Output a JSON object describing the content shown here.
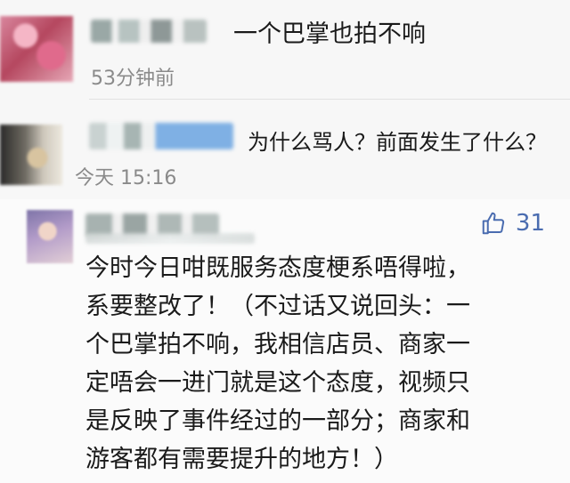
{
  "comments": [
    {
      "text": "一个巴掌也拍不响",
      "time": "53分钟前"
    },
    {
      "text": "为什么骂人？前面发生了什么？",
      "time": "今天 15:16"
    },
    {
      "likes": "31",
      "text_lines": [
        "今时今日咁既服务态度梗系唔得啦，",
        "系要整改了！（不过话又说回头：一",
        "个巴掌拍不响，我相信店员、商家一",
        "定唔会一进门就是这个态度，视频只",
        "是反映了事件经过的一部分；商家和",
        "游客都有需要提升的地方！）"
      ]
    }
  ],
  "icons": {
    "like": "thumbs-up-icon"
  },
  "colors": {
    "like_accent": "#4a6cb0",
    "meta_text": "#8a8a8a",
    "body_text": "#1a1a1a"
  }
}
